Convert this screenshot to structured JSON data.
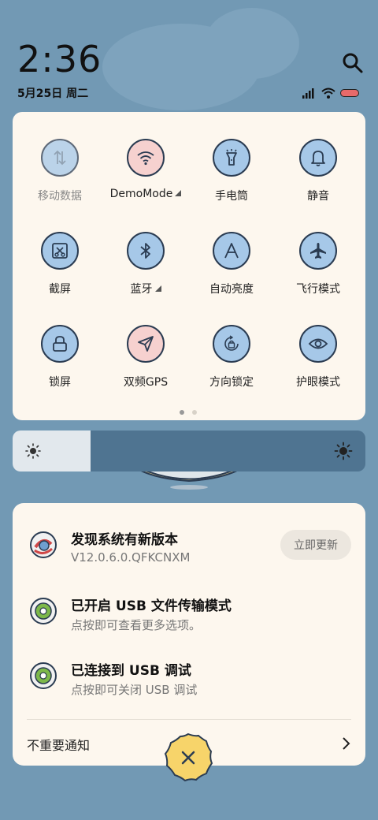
{
  "status_bar": {
    "time": "2:36",
    "date": "5月25日 周二"
  },
  "quick_settings": {
    "tiles": [
      {
        "label": "移动数据",
        "icon": "mobile-data-icon",
        "state": "off"
      },
      {
        "label": "DemoMode",
        "icon": "wifi-icon",
        "state": "on"
      },
      {
        "label": "手电筒",
        "icon": "flashlight-icon",
        "state": "off"
      },
      {
        "label": "静音",
        "icon": "bell-icon",
        "state": "off"
      },
      {
        "label": "截屏",
        "icon": "screenshot-icon",
        "state": "off"
      },
      {
        "label": "蓝牙",
        "icon": "bluetooth-icon",
        "state": "off"
      },
      {
        "label": "自动亮度",
        "icon": "auto-brightness-icon",
        "state": "off"
      },
      {
        "label": "飞行模式",
        "icon": "airplane-icon",
        "state": "off"
      },
      {
        "label": "锁屏",
        "icon": "lock-icon",
        "state": "off"
      },
      {
        "label": "双频GPS",
        "icon": "gps-icon",
        "state": "on"
      },
      {
        "label": "方向锁定",
        "icon": "rotation-lock-icon",
        "state": "off"
      },
      {
        "label": "护眼模式",
        "icon": "eye-icon",
        "state": "off"
      }
    ],
    "page_count": 2,
    "current_page": 1
  },
  "brightness": {
    "level": 0.22
  },
  "notifications": {
    "items": [
      {
        "title": "发现系统有新版本",
        "subtitle": "V12.0.6.0.QFKCNXM",
        "action": "立即更新"
      },
      {
        "title": "已开启 USB 文件传输模式",
        "subtitle": "点按即可查看更多选项。"
      },
      {
        "title": "已连接到 USB 调试",
        "subtitle": "点按即可关闭 USB 调试"
      }
    ],
    "unimportant_label": "不重要通知"
  },
  "colors": {
    "wallpaper": "#7299b4",
    "panel": "#fdf7ee",
    "tile_blue": "#a6c8e8",
    "tile_pink": "#f6d1cf",
    "close_yellow": "#f7d46a"
  }
}
